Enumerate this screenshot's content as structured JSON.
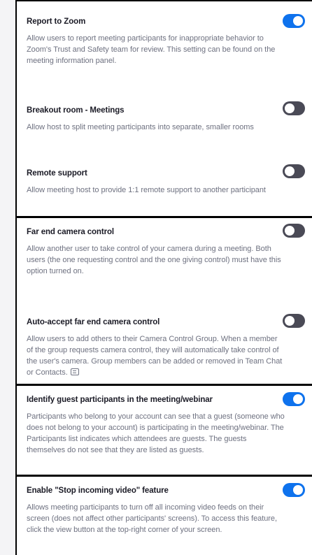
{
  "settings": [
    {
      "title": "Report to Zoom",
      "description": "Allow users to report meeting participants for inappropriate behavior to Zoom's Trust and Safety team for review. This setting can be found on the meeting information panel.",
      "enabled": true
    },
    {
      "title": "Breakout room - Meetings",
      "description": "Allow host to split meeting participants into separate, smaller rooms",
      "enabled": false
    },
    {
      "title": "Remote support",
      "description": "Allow meeting host to provide 1:1 remote support to another participant",
      "enabled": false
    },
    {
      "title": "Far end camera control",
      "description": "Allow another user to take control of your camera during a meeting. Both users (the one requesting control and the one giving control) must have this option turned on.",
      "enabled": false
    },
    {
      "title": "Auto-accept far end camera control",
      "description": "Allow users to add others to their Camera Control Group. When a member of the group requests camera control, they will automatically take control of the user's camera. Group members can be added or removed in Team Chat or Contacts.",
      "icon": "chat-icon",
      "enabled": false
    },
    {
      "title": "Identify guest participants in the meeting/webinar",
      "description": "Participants who belong to your account can see that a guest (someone who does not belong to your account) is participating in the meeting/webinar. The Participants list indicates which attendees are guests. The guests themselves do not see that they are listed as guests.",
      "enabled": true
    },
    {
      "title": "Enable \"Stop incoming video\" feature",
      "description": "Allows meeting participants to turn off all incoming video feeds on their screen (does not affect other participants' screens). To access this feature, click the view button at the top-right corner of your screen.",
      "enabled": true
    }
  ],
  "colors": {
    "toggle_on": "#0e72ed",
    "toggle_off": "#4a4a56",
    "title_text": "#1b1b26",
    "description_text": "#6e7180"
  }
}
